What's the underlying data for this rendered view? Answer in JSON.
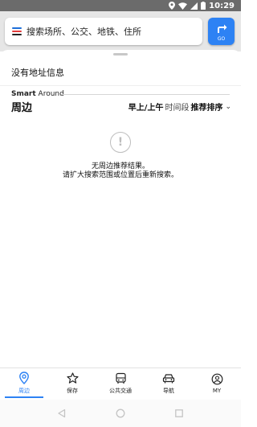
{
  "status_bar": {
    "time": "10:29"
  },
  "search": {
    "placeholder": "搜索场所、公交、地铁、住所",
    "route_button_label": "GO"
  },
  "address_notice": "没有地址信息",
  "nearby": {
    "brand_strong": "Smart",
    "brand_rest": " Around",
    "title": "周边",
    "time_filter": "早上/上午",
    "time_filter_suffix": "时间段",
    "sort_label": "推荐排序"
  },
  "empty_state": {
    "line1": "无周边推荐结果。",
    "line2": "请扩大搜索范围或位置后重新搜索。"
  },
  "bottom_nav": {
    "items": [
      {
        "label": "周边",
        "icon": "location-pin-icon",
        "active": true
      },
      {
        "label": "保存",
        "icon": "star-icon",
        "active": false
      },
      {
        "label": "公共交通",
        "icon": "bus-icon",
        "active": false
      },
      {
        "label": "导航",
        "icon": "car-icon",
        "active": false
      },
      {
        "label": "MY",
        "icon": "user-icon",
        "active": false
      }
    ]
  },
  "colors": {
    "accent": "#2d82f4",
    "status_bar": "#6b6b6b",
    "header_bg": "#e6e6e6",
    "menu_lines": [
      "#1e6fd9",
      "#e23a3a",
      "#222222"
    ]
  }
}
